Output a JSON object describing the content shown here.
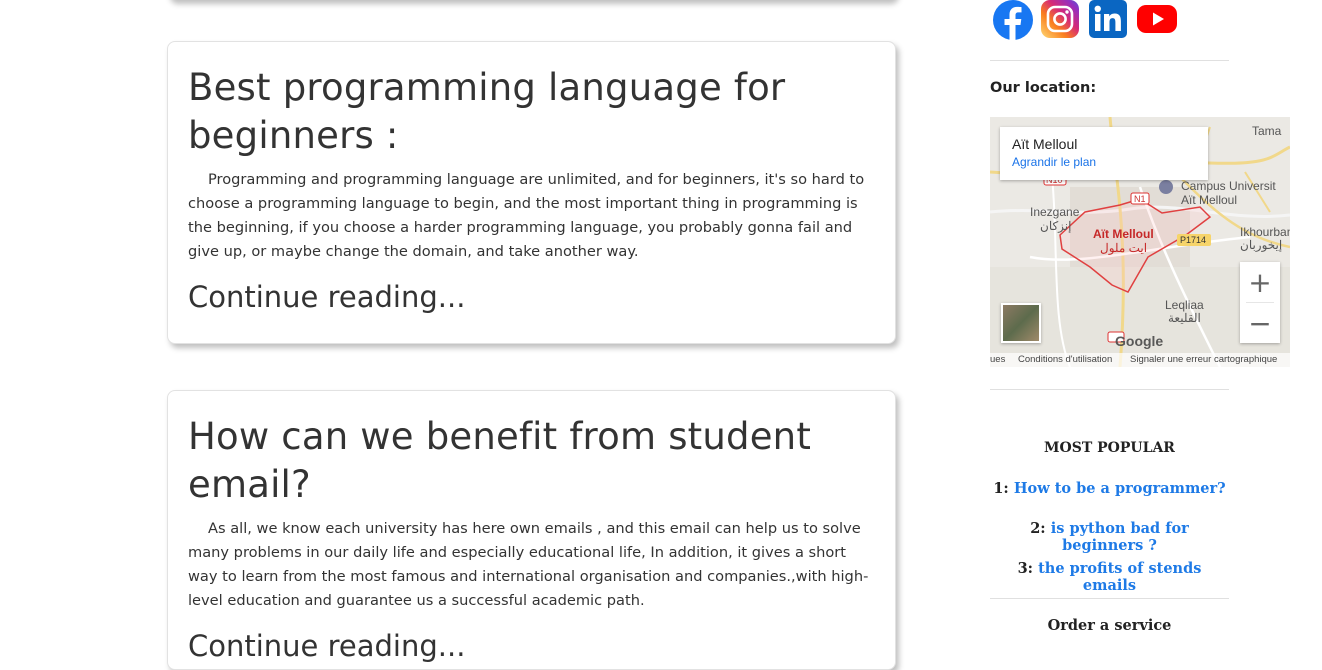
{
  "posts": [
    {
      "title": "Best programming language for beginners :",
      "body": "Programming and programming language are unlimited, and for beginners, it's so hard to choose a programming language to begin, and the most important thing in programming is the beginning, if you choose a harder programming language, you probably gonna fail and give up, or maybe change the domain, and take another way.",
      "more": "Continue reading..."
    },
    {
      "title": "How can we benefit from student email?",
      "body": "As all, we know each university has here own emails , and this email can help us to solve many problems in our daily life and especially educational life, In addition, it gives a short way to learn from the most famous and international organisation and companies.,with high-level education and guarantee us a successful academic path.",
      "more": "Continue reading..."
    }
  ],
  "sidebar": {
    "social": [
      "facebook-icon",
      "instagram-icon",
      "linkedin-icon",
      "youtube-icon"
    ],
    "location_label": "Our location:",
    "map": {
      "place": "Aït Melloul",
      "enlarge_link": "Agrandir le plan",
      "city_label": "Aït Melloul",
      "city_label_ar": "ايت ملول",
      "labels": {
        "inezgane": "Inezgane",
        "inezgane_ar": "إنزكان",
        "campus": "Campus Universit",
        "campus_sub": "Aït Melloul",
        "ikhourban": "Ikhourban",
        "ikhourban_ar": "إيخوربان",
        "leqliaa": "Leqliaa",
        "leqliaa_ar": "القليعة",
        "tama": "Tama",
        "p1714": "P1714",
        "n1": "N1",
        "n10": "N10"
      },
      "google": "Google",
      "footer_left": "ues",
      "footer_terms": "Conditions d'utilisation",
      "footer_report": "Signaler une erreur cartographique",
      "zoom_in": "+",
      "zoom_out": "−"
    },
    "popular": {
      "title": "MOST POPULAR",
      "items": [
        {
          "num": "1:",
          "label": "How to be a programmer?"
        },
        {
          "num": "2:",
          "label": "is python bad for beginners ?"
        },
        {
          "num": "3:",
          "label": "the profits of stends emails"
        }
      ]
    },
    "order_label": "Order a service"
  },
  "colors": {
    "link": "#1e7ae6",
    "text": "#333333",
    "facebook": "#1877f2",
    "linkedin": "#0a66c2",
    "youtube": "#ff0000"
  }
}
